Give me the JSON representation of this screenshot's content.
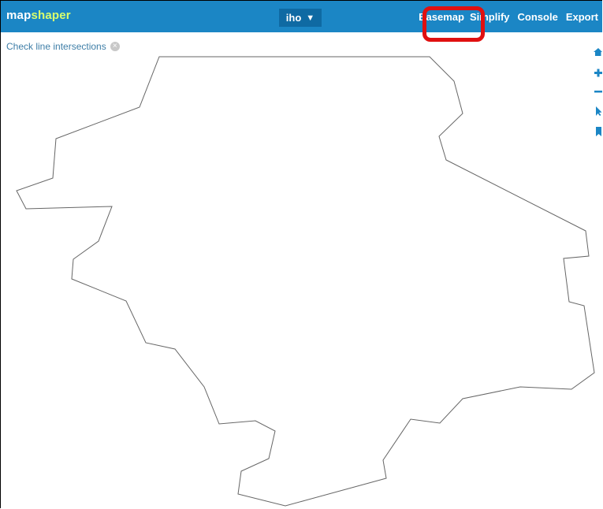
{
  "app": {
    "logo_part1": "map",
    "logo_part2": "shaper"
  },
  "layer_menu": {
    "label": "iho",
    "arrow": "▼"
  },
  "nav": {
    "basemap": "Basemap",
    "simplify": "Simplify",
    "console": "Console",
    "export": "Export"
  },
  "status": {
    "text": "Check line intersections",
    "close_icon": "close-icon"
  },
  "map_tools": [
    "home-icon",
    "zoom-in-icon",
    "zoom-out-icon",
    "pointer-icon",
    "bookmark-icon"
  ],
  "colors": {
    "topbar": "#1b86c5",
    "logo_accent": "#d9ff6e",
    "highlight": "#e01010",
    "shape_stroke": "#666666"
  }
}
